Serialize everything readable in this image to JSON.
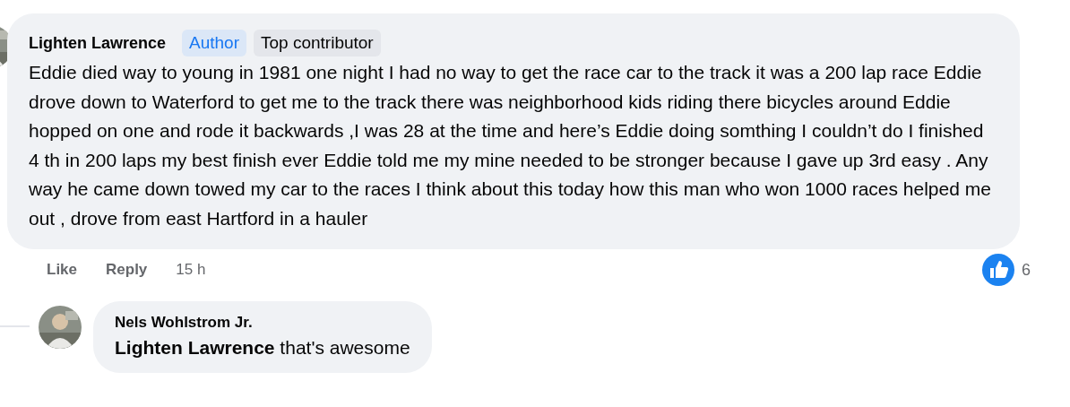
{
  "comment": {
    "author": "Lighten Lawrence",
    "badges": [
      {
        "label": "Author",
        "kind": "author"
      },
      {
        "label": "Top contributor",
        "kind": "contributor"
      }
    ],
    "text": "Eddie died way to young in 1981 one night I had no way to get the race car to the track it was a 200 lap race Eddie drove down to Waterford to get me to the track there was neighborhood kids riding there bicycles around Eddie hopped on one and rode it backwards ,I was 28 at the time and here’s Eddie doing somthing I couldn’t do I finished 4 th in 200 laps my best finish ever Eddie told me my mine needed to be stronger because I gave up 3rd easy . Any way he came down towed my car to the races I think about this today how this man who won 1000 races helped me out , drove from east Hartford in a hauler",
    "actions": [
      "Like",
      "Reply"
    ],
    "time": "15 h",
    "reaction_count": "6"
  },
  "reply": {
    "author": "Nels Wohlstrom Jr.",
    "text": "**Lighten Lawrence** that's awesome"
  }
}
